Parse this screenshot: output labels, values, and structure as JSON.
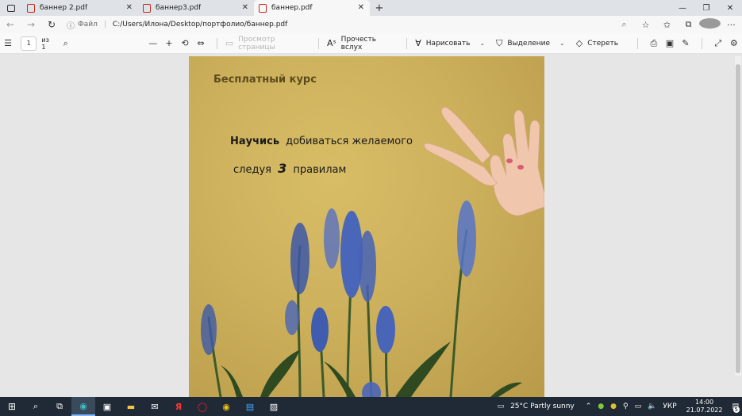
{
  "tabs": [
    {
      "title": "баннер 2.pdf",
      "active": false
    },
    {
      "title": "баннер3.pdf",
      "active": false
    },
    {
      "title": "баннер.pdf",
      "active": true
    }
  ],
  "address": {
    "file_label": "Файл",
    "url": "C:/Users/Илона/Desktop/портфолио/баннер.pdf"
  },
  "pdf_toolbar": {
    "page_number": "1",
    "page_of": "из 1",
    "page_view_label": "Просмотр страницы",
    "read_aloud_label": "Прочесть вслух",
    "draw_label": "Нарисовать",
    "highlight_label": "Выделение",
    "erase_label": "Стереть"
  },
  "document": {
    "headline": "Бесплатный курс",
    "line1_bold": "Научись",
    "line1_rest": "добиваться желаемого",
    "line2_start": "следуя",
    "line2_number": "3",
    "line2_end": "правилам"
  },
  "taskbar": {
    "weather": "25°C  Partly sunny",
    "language": "УКР",
    "time": "14:00",
    "date": "21.07.2022",
    "notification_count": "5"
  },
  "colors": {
    "banner_background": "#cdb05c",
    "headline_color": "#5c4b1d",
    "flower_blue": "#4a66b8",
    "taskbar": "#1f2a36"
  }
}
